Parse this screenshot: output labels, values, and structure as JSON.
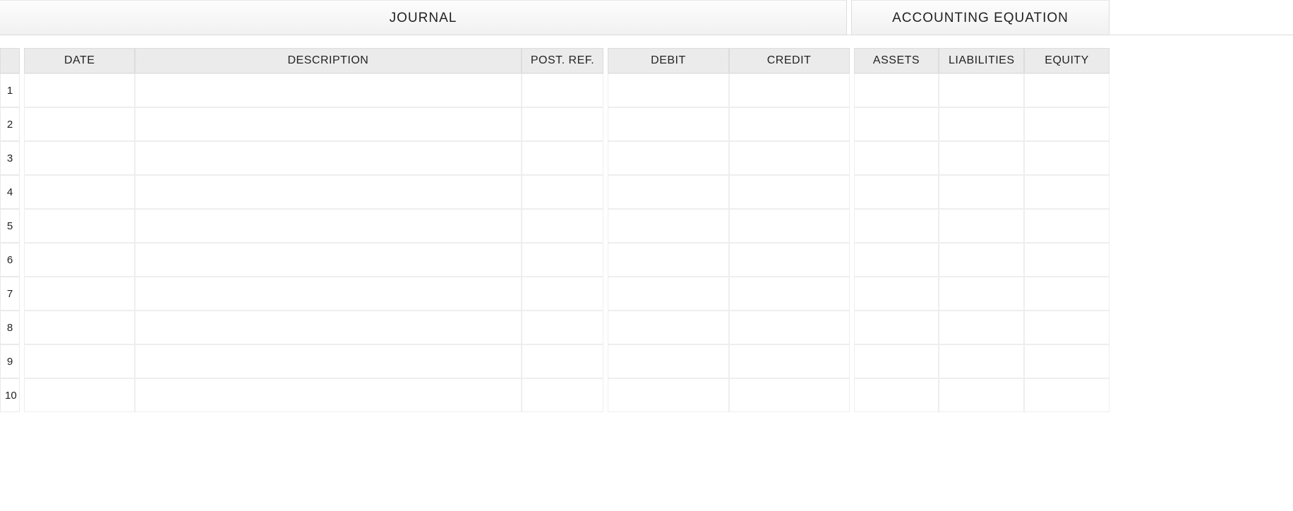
{
  "tabs": {
    "journal": "JOURNAL",
    "equation": "ACCOUNTING EQUATION"
  },
  "columns": {
    "date": "DATE",
    "description": "DESCRIPTION",
    "post_ref": "POST. REF.",
    "debit": "DEBIT",
    "credit": "CREDIT",
    "assets": "ASSETS",
    "liabilities": "LIABILITIES",
    "equity": "EQUITY"
  },
  "rows": [
    {
      "num": "1",
      "date": "",
      "description": "",
      "post_ref": "",
      "debit": "",
      "credit": "",
      "assets": "",
      "liabilities": "",
      "equity": ""
    },
    {
      "num": "2",
      "date": "",
      "description": "",
      "post_ref": "",
      "debit": "",
      "credit": "",
      "assets": "",
      "liabilities": "",
      "equity": ""
    },
    {
      "num": "3",
      "date": "",
      "description": "",
      "post_ref": "",
      "debit": "",
      "credit": "",
      "assets": "",
      "liabilities": "",
      "equity": ""
    },
    {
      "num": "4",
      "date": "",
      "description": "",
      "post_ref": "",
      "debit": "",
      "credit": "",
      "assets": "",
      "liabilities": "",
      "equity": ""
    },
    {
      "num": "5",
      "date": "",
      "description": "",
      "post_ref": "",
      "debit": "",
      "credit": "",
      "assets": "",
      "liabilities": "",
      "equity": ""
    },
    {
      "num": "6",
      "date": "",
      "description": "",
      "post_ref": "",
      "debit": "",
      "credit": "",
      "assets": "",
      "liabilities": "",
      "equity": ""
    },
    {
      "num": "7",
      "date": "",
      "description": "",
      "post_ref": "",
      "debit": "",
      "credit": "",
      "assets": "",
      "liabilities": "",
      "equity": ""
    },
    {
      "num": "8",
      "date": "",
      "description": "",
      "post_ref": "",
      "debit": "",
      "credit": "",
      "assets": "",
      "liabilities": "",
      "equity": ""
    },
    {
      "num": "9",
      "date": "",
      "description": "",
      "post_ref": "",
      "debit": "",
      "credit": "",
      "assets": "",
      "liabilities": "",
      "equity": ""
    },
    {
      "num": "10",
      "date": "",
      "description": "",
      "post_ref": "",
      "debit": "",
      "credit": "",
      "assets": "",
      "liabilities": "",
      "equity": ""
    }
  ]
}
